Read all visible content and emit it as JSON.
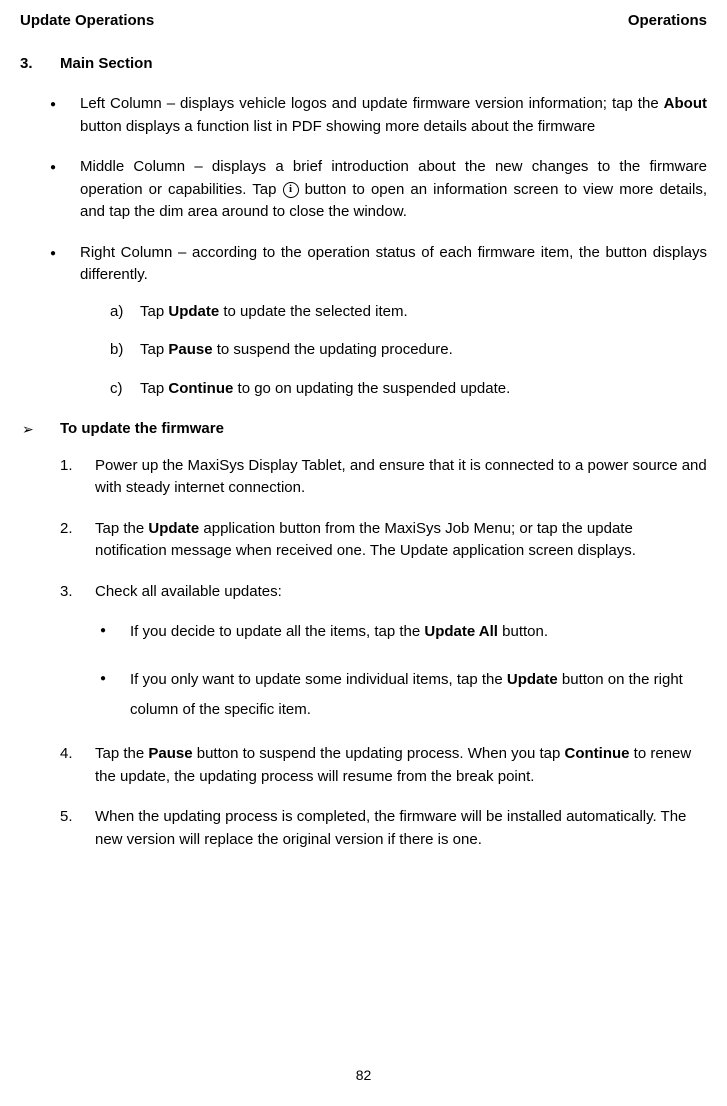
{
  "header": {
    "left": "Update Operations",
    "right": "Operations"
  },
  "section": {
    "number": "3.",
    "title": "Main Section"
  },
  "bullets": {
    "item1_pre": "Left Column – displays vehicle logos and update firmware version information; tap the ",
    "item1_bold": "About",
    "item1_post": " button displays a function list in PDF showing more details about the firmware",
    "item2_pre": "Middle Column – displays a brief introduction about the new changes to the firmware operation or capabilities. Tap ",
    "item2_post": " button to open an information screen to view more details, and tap the dim area around to close the window.",
    "item3": "Right Column – according to the operation status of each firmware item, the button displays differently."
  },
  "subletters": {
    "a_letter": "a)",
    "a_pre": "Tap ",
    "a_bold": "Update",
    "a_post": " to update the selected item.",
    "b_letter": "b)",
    "b_pre": "Tap ",
    "b_bold": "Pause",
    "b_post": " to suspend the updating procedure.",
    "c_letter": "c)",
    "c_pre": "Tap ",
    "c_bold": "Continue",
    "c_post": " to go on updating the suspended update."
  },
  "arrow": {
    "title": "To update the firmware"
  },
  "steps": {
    "n1": "1.",
    "s1": "Power up the MaxiSys Display Tablet, and ensure that it is connected to a power source and with steady internet connection.",
    "n2": "2.",
    "s2_pre": "Tap the ",
    "s2_bold": "Update",
    "s2_post": " application button from the MaxiSys Job Menu; or tap the update notification message when received one. The Update application screen displays.",
    "n3": "3.",
    "s3": "Check all available updates:",
    "s3a_pre": "If you decide to update all the items, tap the ",
    "s3a_bold": "Update All",
    "s3a_post": " button.",
    "s3b_pre": "If you only want to update some individual items, tap the ",
    "s3b_bold": "Update",
    "s3b_post": " button on the right column of the specific item.",
    "n4": "4.",
    "s4_pre": "Tap the ",
    "s4_bold1": "Pause",
    "s4_mid": " button to suspend the updating process. When you tap ",
    "s4_bold2": "Continue",
    "s4_post": " to renew the update, the updating process will resume from the break point.",
    "n5": "5.",
    "s5": "When the updating process is completed, the firmware will be installed automatically. The new version will replace the original version if there is one."
  },
  "info_icon": "i",
  "page_number": "82"
}
